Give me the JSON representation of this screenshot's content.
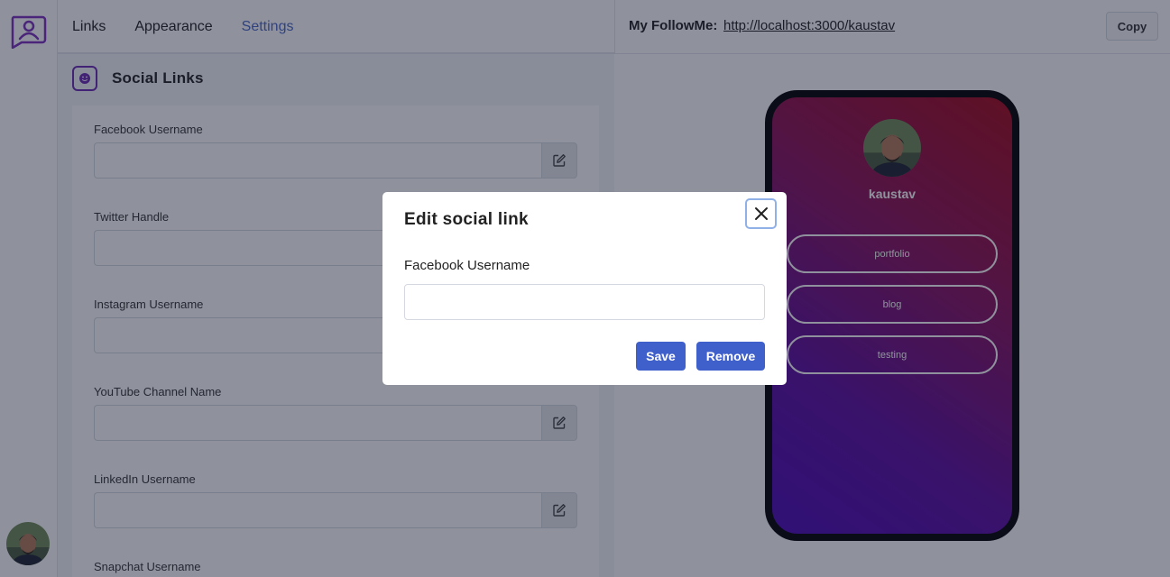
{
  "tabs": [
    {
      "label": "Links"
    },
    {
      "label": "Appearance"
    },
    {
      "label": "Settings"
    }
  ],
  "section": {
    "title": "Social Links"
  },
  "fields": [
    {
      "label": "Facebook Username"
    },
    {
      "label": "Twitter Handle"
    },
    {
      "label": "Instagram Username"
    },
    {
      "label": "YouTube Channel Name"
    },
    {
      "label": "LinkedIn Username"
    },
    {
      "label": "Snapchat Username"
    }
  ],
  "header": {
    "label": "My FollowMe:",
    "url": "http://localhost:3000/kaustav",
    "copy_label": "Copy"
  },
  "profile": {
    "name": "kaustav",
    "links": [
      {
        "label": "portfolio"
      },
      {
        "label": "blog"
      },
      {
        "label": "testing"
      }
    ]
  },
  "modal": {
    "title": "Edit social link",
    "field_label": "Facebook Username",
    "field_value": "",
    "save_label": "Save",
    "remove_label": "Remove"
  },
  "colors": {
    "accent": "#3f5fcb",
    "brand": "#6a2ab3",
    "gradient_start": "#a3071a",
    "gradient_end": "#4b08b8"
  }
}
